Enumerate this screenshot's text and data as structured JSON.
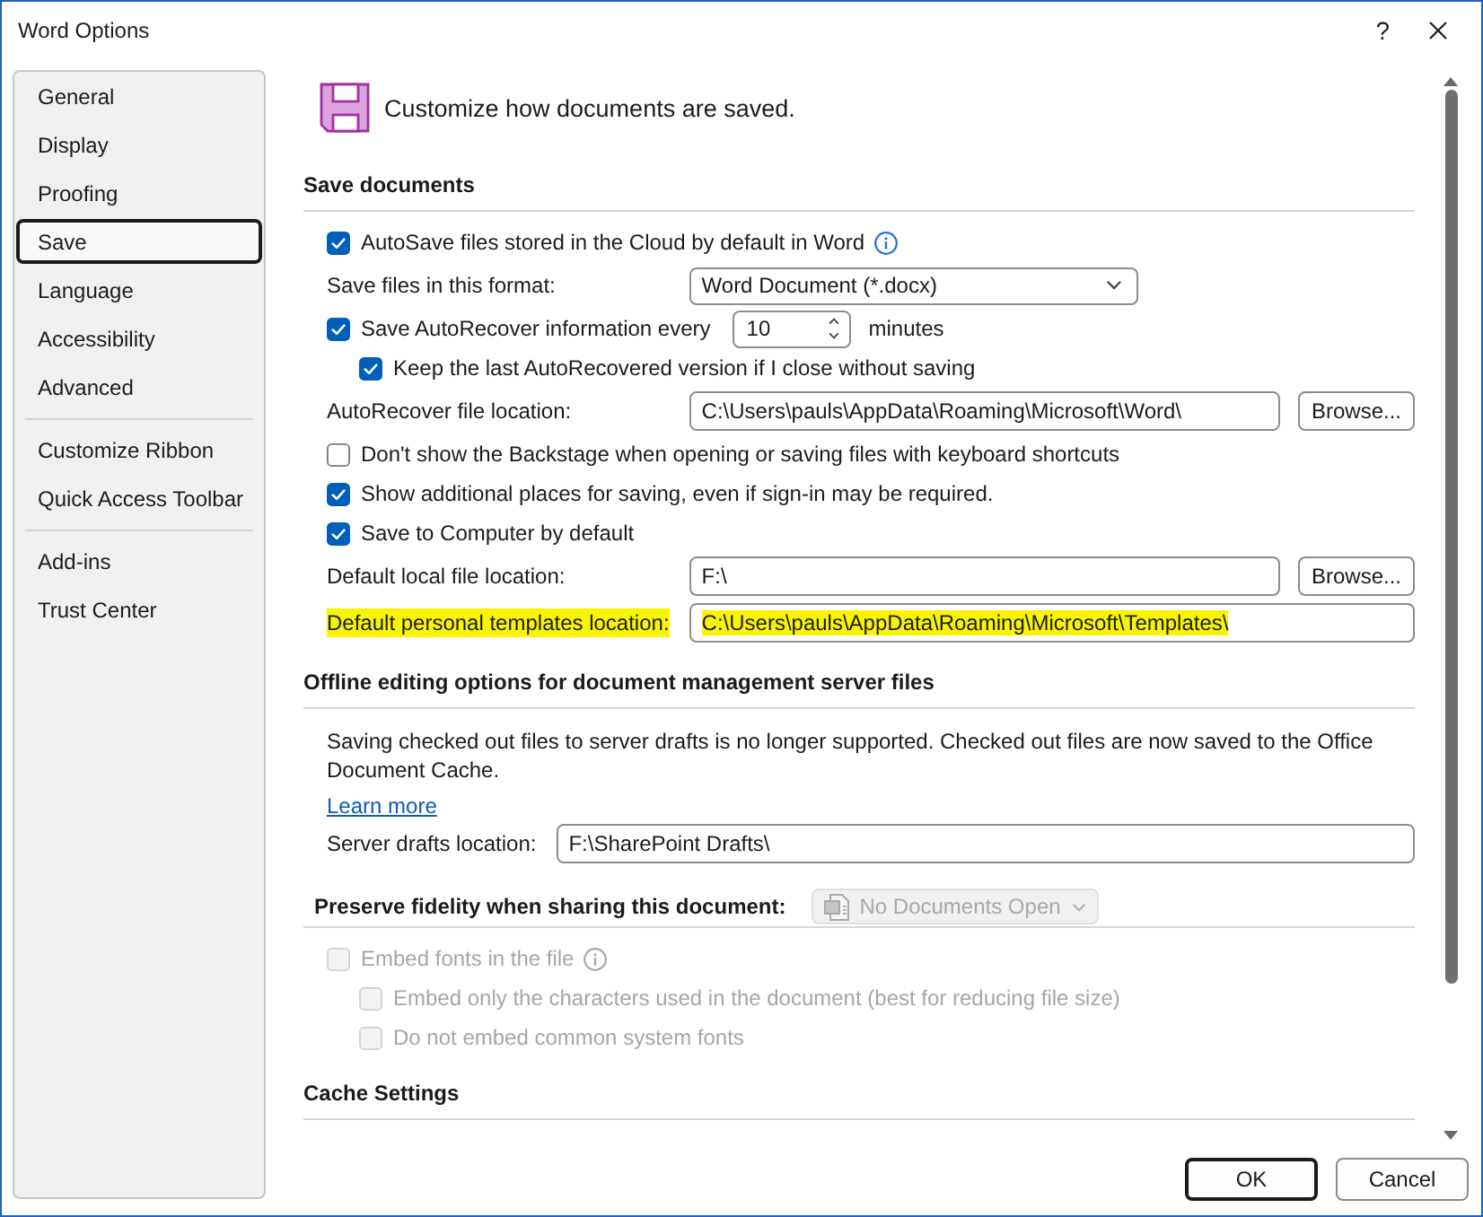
{
  "window": {
    "title": "Word Options",
    "help": "?"
  },
  "sidebar": {
    "groups": [
      {
        "items": [
          {
            "label": "General",
            "selected": false
          },
          {
            "label": "Display",
            "selected": false
          },
          {
            "label": "Proofing",
            "selected": false
          },
          {
            "label": "Save",
            "selected": true
          },
          {
            "label": "Language",
            "selected": false
          },
          {
            "label": "Accessibility",
            "selected": false
          },
          {
            "label": "Advanced",
            "selected": false
          }
        ]
      },
      {
        "items": [
          {
            "label": "Customize Ribbon",
            "selected": false
          },
          {
            "label": "Quick Access Toolbar",
            "selected": false
          }
        ]
      },
      {
        "items": [
          {
            "label": "Add-ins",
            "selected": false
          },
          {
            "label": "Trust Center",
            "selected": false
          }
        ]
      }
    ]
  },
  "header": {
    "text": "Customize how documents are saved."
  },
  "sections": [
    {
      "title": "Save documents",
      "rows": [
        {
          "kind": "checkbox",
          "label": "AutoSave files stored in the Cloud by default in Word",
          "checked": true,
          "disabled": false,
          "info": true
        },
        {
          "kind": "dropdown",
          "label": "Save files in this format:",
          "value": "Word Document (*.docx)"
        },
        {
          "kind": "checkbox",
          "label": "Save AutoRecover information every",
          "checked": true,
          "disabled": false,
          "spin": {
            "value": "10",
            "unit": "minutes"
          },
          "children": [
            {
              "kind": "checkbox",
              "label": "Keep the last AutoRecovered version if I close without saving",
              "checked": true,
              "disabled": false
            }
          ]
        },
        {
          "kind": "path",
          "label": "AutoRecover file location:",
          "value": "C:\\Users\\pauls\\AppData\\Roaming\\Microsoft\\Word\\",
          "button": "Browse...",
          "highlighted": false
        },
        {
          "kind": "checkbox",
          "label": "Don't show the Backstage when opening or saving files with keyboard shortcuts",
          "checked": false,
          "disabled": false
        },
        {
          "kind": "checkbox",
          "label": "Show additional places for saving, even if sign-in may be required.",
          "checked": true,
          "disabled": false
        },
        {
          "kind": "checkbox",
          "label": "Save to Computer by default",
          "checked": true,
          "disabled": false
        },
        {
          "kind": "path",
          "label": "Default local file location:",
          "value": "F:\\",
          "button": "Browse...",
          "highlighted": false
        },
        {
          "kind": "path",
          "label": "Default personal templates location:",
          "value": "C:\\Users\\pauls\\AppData\\Roaming\\Microsoft\\Templates\\",
          "highlighted": true
        }
      ]
    },
    {
      "title": "Offline editing options for document management server files",
      "rows": [
        {
          "kind": "note",
          "text": "Saving checked out files to server drafts is no longer supported. Checked out files are now saved to the Office Document Cache."
        },
        {
          "kind": "link",
          "text": "Learn more"
        },
        {
          "kind": "path",
          "label": "Server drafts location:",
          "value": "F:\\SharePoint Drafts\\",
          "highlighted": false
        }
      ]
    },
    {
      "title": "Preserve fidelity when sharing this document:",
      "dropdown": {
        "value": "No Documents Open",
        "disabled": true
      },
      "rows": [
        {
          "kind": "checkbox",
          "label": "Embed fonts in the file",
          "checked": false,
          "disabled": true,
          "info": true,
          "children": [
            {
              "kind": "checkbox",
              "label": "Embed only the characters used in the document (best for reducing file size)",
              "checked": false,
              "disabled": true
            },
            {
              "kind": "checkbox",
              "label": "Do not embed common system fonts",
              "checked": false,
              "disabled": true
            }
          ]
        }
      ]
    },
    {
      "title": "Cache Settings"
    }
  ],
  "buttons": [
    {
      "label": "OK",
      "default": true
    },
    {
      "label": "Cancel",
      "default": false
    }
  ]
}
